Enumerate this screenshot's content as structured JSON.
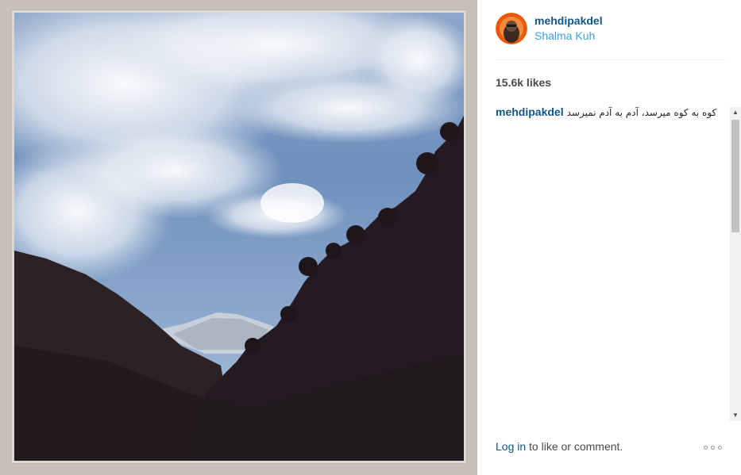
{
  "post": {
    "image_alt": "Mountain valley under a blue sky with clouds",
    "username": "mehdipakdel",
    "location": "Shalma Kuh",
    "likes": "15.6k likes",
    "caption_user": "mehdipakdel",
    "caption_text": "کوه به کوه میرسد، آدم به آدم نمیرسد",
    "login_link": "Log in",
    "login_suffix": " to like or comment."
  },
  "scrollbar": {
    "up_glyph": "▲",
    "down_glyph": "▼"
  },
  "icons": {
    "avatar": "avatar",
    "more": "more-options-icon",
    "scroll_up": "scroll-up-arrow-icon",
    "scroll_down": "scroll-down-arrow-icon"
  },
  "colors": {
    "username": "#125688",
    "location": "#3f9fdc",
    "frame": "#c7c0ba"
  }
}
